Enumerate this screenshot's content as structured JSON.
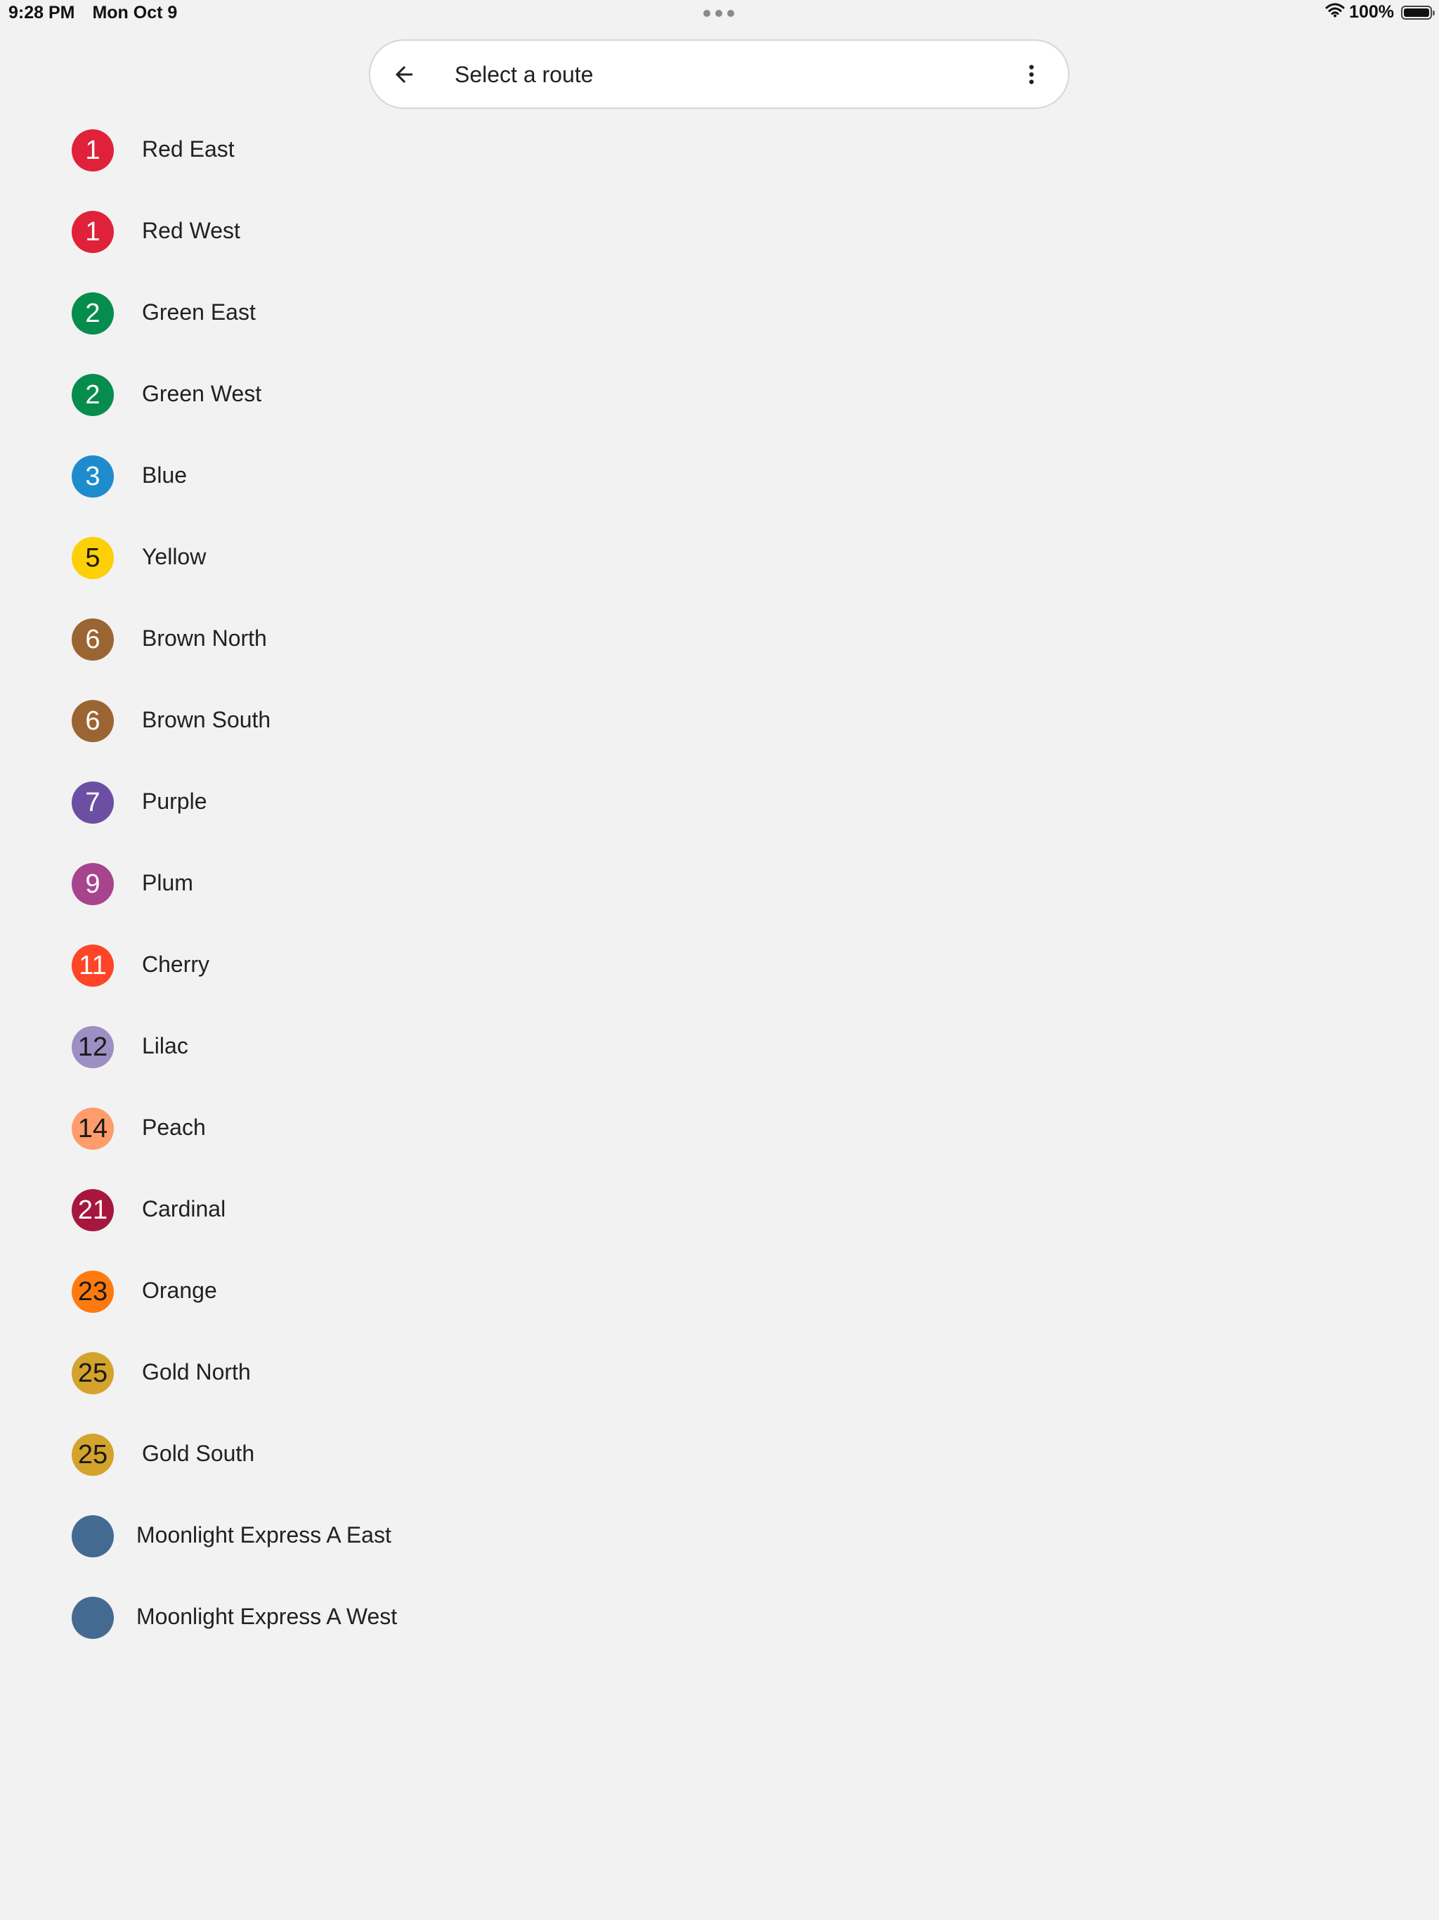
{
  "status_bar": {
    "time": "9:28 PM",
    "date": "Mon Oct 9",
    "battery": "100%",
    "icons": [
      "wifi-icon",
      "battery-icon",
      "multitasking-dots-icon"
    ]
  },
  "search_bar": {
    "title": "Select a route",
    "back_icon": "arrow-left-icon",
    "menu_icon": "more-vert-icon"
  },
  "routes": [
    {
      "number": "1",
      "name": "Red East",
      "color": "#e0213a",
      "text_color": "#ffffff"
    },
    {
      "number": "1",
      "name": "Red West",
      "color": "#e0213a",
      "text_color": "#ffffff"
    },
    {
      "number": "2",
      "name": "Green East",
      "color": "#068d4e",
      "text_color": "#ffffff"
    },
    {
      "number": "2",
      "name": "Green West",
      "color": "#068d4e",
      "text_color": "#ffffff"
    },
    {
      "number": "3",
      "name": "Blue",
      "color": "#1e8bcd",
      "text_color": "#ffffff"
    },
    {
      "number": "5",
      "name": "Yellow",
      "color": "#fdcf06",
      "text_color": "#1a1a1a"
    },
    {
      "number": "6",
      "name": "Brown North",
      "color": "#9b6533",
      "text_color": "#ffffff"
    },
    {
      "number": "6",
      "name": "Brown South",
      "color": "#9b6533",
      "text_color": "#ffffff"
    },
    {
      "number": "7",
      "name": "Purple",
      "color": "#6c4fa3",
      "text_color": "#ffffff"
    },
    {
      "number": "9",
      "name": "Plum",
      "color": "#a6448e",
      "text_color": "#ffffff"
    },
    {
      "number": "11",
      "name": "Cherry",
      "color": "#ff4527",
      "text_color": "#ffffff"
    },
    {
      "number": "12",
      "name": "Lilac",
      "color": "#9c8fc3",
      "text_color": "#1a1a1a"
    },
    {
      "number": "14",
      "name": "Peach",
      "color": "#ff9c6b",
      "text_color": "#1a1a1a"
    },
    {
      "number": "21",
      "name": "Cardinal",
      "color": "#a6173e",
      "text_color": "#ffffff"
    },
    {
      "number": "23",
      "name": "Orange",
      "color": "#ff7a0e",
      "text_color": "#1a1a1a"
    },
    {
      "number": "25",
      "name": "Gold North",
      "color": "#d4a32c",
      "text_color": "#1a1a1a"
    },
    {
      "number": "25",
      "name": "Gold South",
      "color": "#d4a32c",
      "text_color": "#1a1a1a"
    },
    {
      "number": "",
      "name": "Moonlight Express A East",
      "color": "#456a92",
      "text_color": "#ffffff"
    },
    {
      "number": "",
      "name": "Moonlight Express A West",
      "color": "#456a92",
      "text_color": "#ffffff"
    }
  ]
}
